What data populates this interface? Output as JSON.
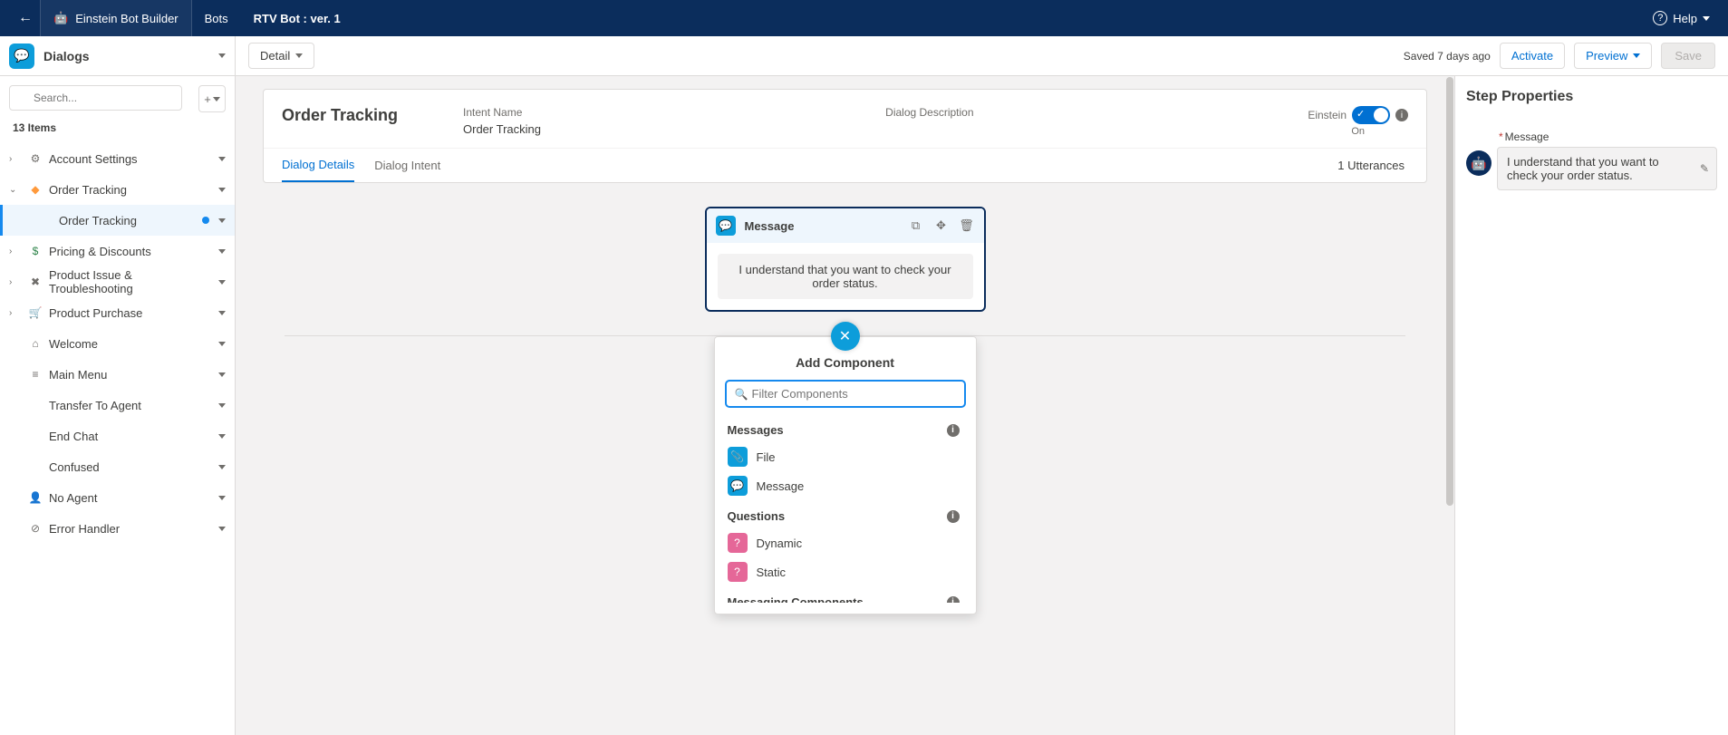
{
  "navbar": {
    "brand": "Einstein Bot Builder",
    "nav_bots": "Bots",
    "title": "RTV Bot : ver. 1",
    "help": "Help"
  },
  "sidebar_header": {
    "title": "Dialogs"
  },
  "actionbar": {
    "detail": "Detail",
    "saved": "Saved 7 days ago",
    "activate": "Activate",
    "preview": "Preview",
    "save": "Save"
  },
  "sidebar": {
    "search_placeholder": "Search...",
    "count": "13 Items",
    "items": [
      {
        "icon": "⚙",
        "icon_color": "#706e6b",
        "label": "Account Settings",
        "exp": "›"
      },
      {
        "icon": "◆",
        "icon_color": "#ff9a3c",
        "label": "Order Tracking",
        "exp": "⌄",
        "expanded": true,
        "child": "Order Tracking"
      },
      {
        "icon": "$",
        "icon_color": "#2e844a",
        "label": "Pricing & Discounts",
        "exp": "›"
      },
      {
        "icon": "✖",
        "icon_color": "#706e6b",
        "label": "Product Issue & Troubleshooting",
        "exp": "›"
      },
      {
        "icon": "🛒",
        "icon_color": "#706e6b",
        "label": "Product Purchase",
        "exp": "›"
      },
      {
        "icon": "⌂",
        "icon_color": "#706e6b",
        "label": "Welcome",
        "exp": ""
      },
      {
        "icon": "≡",
        "icon_color": "#706e6b",
        "label": "Main Menu",
        "exp": ""
      },
      {
        "icon": "",
        "icon_color": "",
        "label": "Transfer To Agent",
        "exp": ""
      },
      {
        "icon": "",
        "icon_color": "",
        "label": "End Chat",
        "exp": ""
      },
      {
        "icon": "",
        "icon_color": "",
        "label": "Confused",
        "exp": ""
      },
      {
        "icon": "👤",
        "icon_color": "#706e6b",
        "label": "No Agent",
        "exp": ""
      },
      {
        "icon": "⊘",
        "icon_color": "#706e6b",
        "label": "Error Handler",
        "exp": ""
      }
    ]
  },
  "card": {
    "title": "Order Tracking",
    "intent_label": "Intent Name",
    "intent_value": "Order Tracking",
    "desc_label": "Dialog Description",
    "einstein_label": "Einstein",
    "einstein_on": "On",
    "tab_details": "Dialog Details",
    "tab_intent": "Dialog Intent",
    "utterances": "1 Utterances"
  },
  "message_card": {
    "header": "Message",
    "text": "I understand that you want to check your order status."
  },
  "popover": {
    "title": "Add Component",
    "filter_placeholder": "Filter Components",
    "groups": [
      {
        "title": "Messages",
        "items": [
          {
            "icon_class": "blue",
            "glyph": "📎",
            "label": "File"
          },
          {
            "icon_class": "blue",
            "glyph": "💬",
            "label": "Message"
          }
        ]
      },
      {
        "title": "Questions",
        "items": [
          {
            "icon_class": "pink",
            "glyph": "?",
            "label": "Dynamic"
          },
          {
            "icon_class": "pink",
            "glyph": "?",
            "label": "Static"
          }
        ]
      },
      {
        "title": "Messaging Components",
        "items": [
          {
            "icon_class": "teal",
            "glyph": "▭",
            "label": ""
          }
        ]
      }
    ]
  },
  "right": {
    "title": "Step Properties",
    "field_label": "Message",
    "message": "I understand that you want to check your order status."
  }
}
